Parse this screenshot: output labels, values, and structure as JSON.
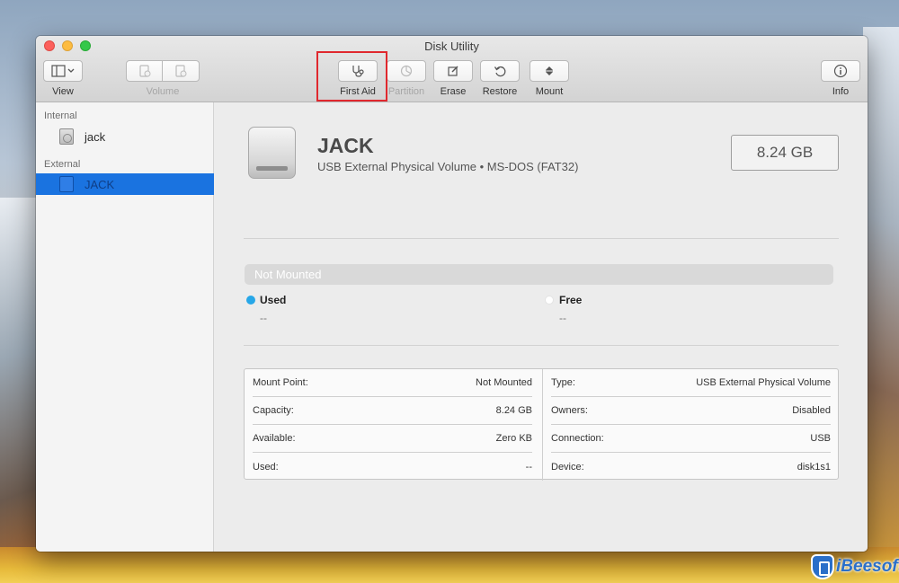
{
  "window": {
    "title": "Disk Utility"
  },
  "toolbar": {
    "view_label": "View",
    "volume_label": "Volume",
    "first_aid_label": "First Aid",
    "partition_label": "Partition",
    "erase_label": "Erase",
    "restore_label": "Restore",
    "mount_label": "Mount",
    "info_label": "Info"
  },
  "sidebar": {
    "internal_header": "Internal",
    "external_header": "External",
    "internal_items": [
      {
        "label": "jack"
      }
    ],
    "external_items": [
      {
        "label": "JACK",
        "selected": true
      }
    ]
  },
  "volume": {
    "name": "JACK",
    "description": "USB External Physical Volume • MS-DOS (FAT32)",
    "size": "8.24 GB",
    "status": "Not Mounted"
  },
  "usage": {
    "used_label": "Used",
    "used_value": "--",
    "used_color": "#27a7e8",
    "free_label": "Free",
    "free_value": "--",
    "free_color": "#ffffff"
  },
  "info": {
    "left": [
      {
        "label": "Mount Point:",
        "value": "Not Mounted"
      },
      {
        "label": "Capacity:",
        "value": "8.24 GB"
      },
      {
        "label": "Available:",
        "value": "Zero KB"
      },
      {
        "label": "Used:",
        "value": "--"
      }
    ],
    "right": [
      {
        "label": "Type:",
        "value": "USB External Physical Volume"
      },
      {
        "label": "Owners:",
        "value": "Disabled"
      },
      {
        "label": "Connection:",
        "value": "USB"
      },
      {
        "label": "Device:",
        "value": "disk1s1"
      }
    ]
  },
  "watermark": {
    "text": "iBeesoft"
  },
  "colors": {
    "selection": "#1a73e0",
    "highlight_box": "#e0282e"
  }
}
